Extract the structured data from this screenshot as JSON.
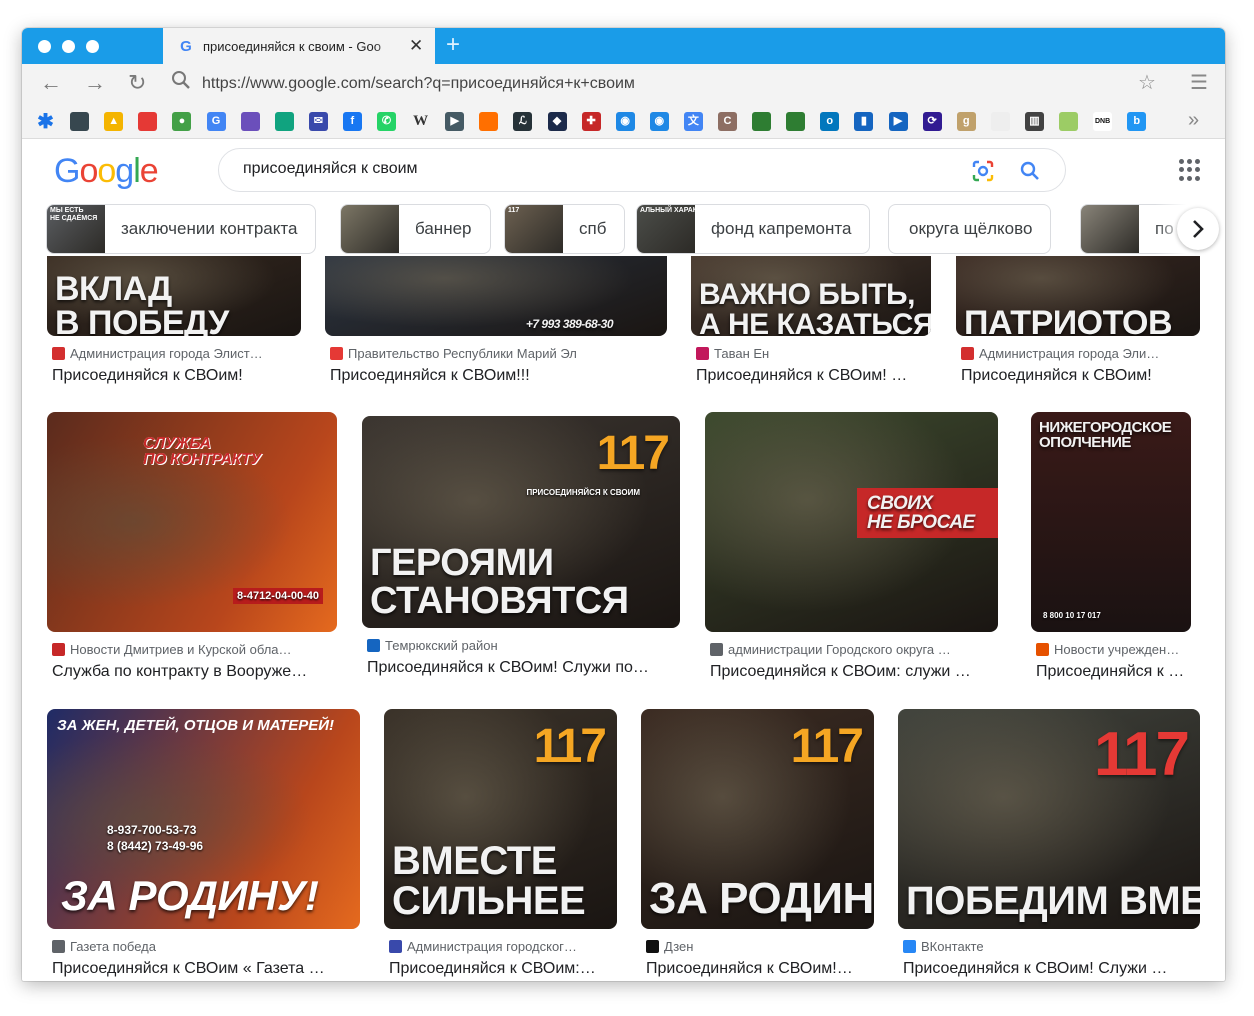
{
  "browser": {
    "tab": {
      "title": "присоединяйся к своим - Goo",
      "favicon": "G"
    },
    "new_tab_label": "+",
    "url": "https://www.google.com/search?q=присоединяйся+к+своим",
    "bookmark_icons": [
      {
        "name": "asterisk-bookmark-icon",
        "glyph": "✱",
        "color": "#1a73e8"
      },
      {
        "name": "photo-bookmark-icon",
        "glyph": "",
        "color": "#37474f"
      },
      {
        "name": "drive-bookmark-icon",
        "glyph": "▲",
        "color": "#f4b400"
      },
      {
        "name": "rainbow-bookmark-icon",
        "glyph": "",
        "color": "#e53935"
      },
      {
        "name": "green-dot-bookmark-icon",
        "glyph": "●",
        "color": "#43a047"
      },
      {
        "name": "google-bookmark-icon",
        "glyph": "G",
        "color": "#4285f4"
      },
      {
        "name": "slack-bookmark-icon",
        "glyph": "",
        "color": "#6b4fbb"
      },
      {
        "name": "openai-bookmark-icon",
        "glyph": "",
        "color": "#10a37f"
      },
      {
        "name": "mail-bookmark-icon",
        "glyph": "✉",
        "color": "#3949ab"
      },
      {
        "name": "facebook-bookmark-icon",
        "glyph": "f",
        "color": "#1877f2"
      },
      {
        "name": "whatsapp-bookmark-icon",
        "glyph": "✆",
        "color": "#25d366"
      },
      {
        "name": "wikipedia-bookmark-icon",
        "glyph": "W",
        "color": "#333333"
      },
      {
        "name": "arrow-bookmark-icon",
        "glyph": "▶",
        "color": "#455a64"
      },
      {
        "name": "colorful-bookmark-icon",
        "glyph": "",
        "color": "#ff6f00"
      },
      {
        "name": "code-bookmark-icon",
        "glyph": "ℒ",
        "color": "#263238"
      },
      {
        "name": "cube-bookmark-icon",
        "glyph": "◆",
        "color": "#1c2a4a"
      },
      {
        "name": "red-bookmark-icon",
        "glyph": "✚",
        "color": "#c62828"
      },
      {
        "name": "globe-bookmark-icon",
        "glyph": "◉",
        "color": "#1e88e5"
      },
      {
        "name": "globe2-bookmark-icon",
        "glyph": "◉",
        "color": "#1e88e5"
      },
      {
        "name": "translate-bookmark-icon",
        "glyph": "文",
        "color": "#4285f4"
      },
      {
        "name": "c-bookmark-icon",
        "glyph": "C",
        "color": "#8d6e63"
      },
      {
        "name": "bookmark-green-icon",
        "glyph": "",
        "color": "#2e7d32"
      },
      {
        "name": "bookmark-green2-icon",
        "glyph": "",
        "color": "#2e7d32"
      },
      {
        "name": "open-bookmark-icon",
        "glyph": "o",
        "color": "#0277bd"
      },
      {
        "name": "chart-bookmark-icon",
        "glyph": "▮",
        "color": "#1565c0"
      },
      {
        "name": "play-bookmark-icon",
        "glyph": "▶",
        "color": "#1565c0"
      },
      {
        "name": "loop-bookmark-icon",
        "glyph": "⟳",
        "color": "#311b92"
      },
      {
        "name": "g-bookmark-icon",
        "glyph": "g",
        "color": "#c0a16b"
      },
      {
        "name": "blank-bookmark-icon",
        "glyph": "",
        "color": "#eeeeee"
      },
      {
        "name": "building-bookmark-icon",
        "glyph": "▥",
        "color": "#424242"
      },
      {
        "name": "leaf-bookmark-icon",
        "glyph": "",
        "color": "#9ccc65"
      },
      {
        "name": "dnb-bookmark-icon",
        "glyph": "DNB",
        "color": "#111111"
      },
      {
        "name": "b-bookmark-icon",
        "glyph": "b",
        "color": "#2196f3"
      }
    ]
  },
  "google": {
    "logo_letters": [
      {
        "ch": "G",
        "color": "#4285f4"
      },
      {
        "ch": "o",
        "color": "#ea4335"
      },
      {
        "ch": "o",
        "color": "#fbbc05"
      },
      {
        "ch": "g",
        "color": "#4285f4"
      },
      {
        "ch": "l",
        "color": "#34a853"
      },
      {
        "ch": "e",
        "color": "#ea4335"
      }
    ],
    "query": "присоединяйся к своим",
    "chips": [
      {
        "label": "заключении контракта",
        "thumb_caption": "МЫ ЕСТЬ\nНЕ СДАЁМСЯ",
        "thumb_color": "#5b5e62"
      },
      {
        "label": "баннер",
        "thumb_caption": "",
        "thumb_color": "#7d7766"
      },
      {
        "label": "спб",
        "thumb_caption": "117",
        "thumb_color": "#6d6151"
      },
      {
        "label": "фонд капремонта",
        "thumb_caption": "АЛЬНЫЙ ХАРАКТЕ",
        "thumb_color": "#4c4e4a"
      },
      {
        "label": "округа щёлково",
        "thumb_caption": "",
        "thumb_color": ""
      },
      {
        "label": "по к",
        "thumb_caption": "",
        "thumb_color": "#8a857a"
      }
    ],
    "results": [
      {
        "source": "Администрация города Элист…",
        "title": "Присоединяйся к СВОим!",
        "icon_color": "#d32f2f",
        "thumb_text": "ВКЛАД\nВ ПОБЕДУ",
        "thumb_color": "#3a2c22"
      },
      {
        "source": "Правительство Республики Марий Эл",
        "title": "Присоединяйся к СВОим!!!",
        "icon_color": "#e53935",
        "thumb_text": "+7 993 389-68-30",
        "thumb_color": "#2c3644"
      },
      {
        "source": "Таван Ен",
        "title": "Присоединяйся к СВОим! …",
        "icon_color": "#c2185b",
        "thumb_text": "ВАЖНО БЫТЬ,\nА НЕ КАЗАТЬСЯ",
        "thumb_color": "#4a3a30"
      },
      {
        "source": "Администрация города Эли…",
        "title": "Присоединяйся к СВОим!",
        "icon_color": "#d32f2f",
        "thumb_text": "ПАТРИОТОВ",
        "thumb_color": "#3d2b24"
      },
      {
        "source": "Новости Дмитриев и Курской обла…",
        "title": "Служба по контракту в Вооруже…",
        "icon_color": "#c62828",
        "thumb_text": "СЛУЖБА\nПО КОНТРАКТУ",
        "thumb_extra": "8-4712-04-00-40",
        "thumb_color": "#5a2b1d"
      },
      {
        "source": "Темрюкский район",
        "title": "Присоединяйся к СВОим! Служи по…",
        "icon_color": "#1565c0",
        "thumb_text": "ГЕРОЯМИ\nСТАНОВЯТСЯ",
        "thumb_big": "117",
        "thumb_extra": "ПРИСОЕДИНЯЙСЯ К СВОИМ",
        "thumb_color": "#3b3530"
      },
      {
        "source": "администрации Городского округа …",
        "title": "Присоединяйся к СВОим: служи …",
        "icon_color": "#5f6368",
        "thumb_text": "СВОИХ\nНЕ БРОСАЕ",
        "thumb_color": "#3d4a2e"
      },
      {
        "source": "Новости учрежден…",
        "title": "Присоединяйся к …",
        "icon_color": "#e65100",
        "thumb_text": "НИЖЕГОРОДСКОЕ\nОПОЛЧЕНИЕ",
        "thumb_extra": "8 800 10 17 017",
        "thumb_color": "#2a1a19"
      },
      {
        "source": "Газета победа",
        "title": "Присоединяйся к СВОим « Газета …",
        "icon_color": "#5f6368",
        "thumb_text": "ЗА РОДИНУ!",
        "thumb_top": "ЗА ЖЕН, ДЕТЕЙ, ОТЦОВ И МАТЕРЕЙ!",
        "thumb_extra": "8-937-700-53-73\n8 (8442) 73-49-96",
        "thumb_color": "#1f2b66"
      },
      {
        "source": "Администрация городског…",
        "title": "Присоединяйся к СВОим:…",
        "icon_color": "#3949ab",
        "thumb_text": "ВМЕСТЕ\nСИЛЬНЕЕ",
        "thumb_big": "117",
        "thumb_color": "#3a3229"
      },
      {
        "source": "Дзен",
        "title": "Присоединяйся к СВОим!…",
        "icon_color": "#111111",
        "thumb_text": "ЗА РОДИНУ",
        "thumb_big": "117",
        "thumb_color": "#3b2b22"
      },
      {
        "source": "ВКонтакте",
        "title": "Присоединяйся к СВОим! Служи …",
        "icon_color": "#2787f5",
        "thumb_text": "ПОБЕДИМ ВМЕСТЕ",
        "thumb_big": "117",
        "thumb_color": "#41443d"
      }
    ]
  }
}
